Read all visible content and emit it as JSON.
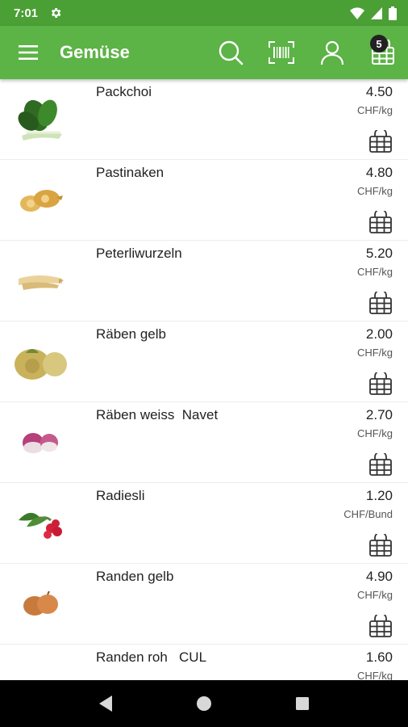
{
  "status": {
    "time": "7:01"
  },
  "appbar": {
    "title": "Gemüse",
    "cart_count": "5",
    "colors": {
      "bar": "#5cb346",
      "status": "#4a9f35"
    }
  },
  "icons": {
    "menu": "menu-icon",
    "search": "search-icon",
    "barcode": "barcode-icon",
    "account": "user-icon",
    "cart": "basket-icon"
  },
  "products": [
    {
      "name": "Packchoi",
      "price": "4.50",
      "unit": "CHF/kg",
      "image": "packchoi"
    },
    {
      "name": "Pastinaken",
      "price": "4.80",
      "unit": "CHF/kg",
      "image": "pastinaken"
    },
    {
      "name": "Peterliwurzeln",
      "price": "5.20",
      "unit": "CHF/kg",
      "image": "peterliwurzeln"
    },
    {
      "name": "Räben gelb",
      "price": "2.00",
      "unit": "CHF/kg",
      "image": "raeben-gelb"
    },
    {
      "name": "Räben weiss  Navet",
      "price": "2.70",
      "unit": "CHF/kg",
      "image": "raeben-weiss"
    },
    {
      "name": "Radiesli",
      "price": "1.20",
      "unit": "CHF/Bund",
      "image": "radiesli"
    },
    {
      "name": "Randen gelb",
      "price": "4.90",
      "unit": "CHF/kg",
      "image": "randen-gelb"
    },
    {
      "name": "Randen roh   CUL",
      "price": "1.60",
      "unit": "CHF/kg",
      "image": "randen-roh"
    }
  ]
}
